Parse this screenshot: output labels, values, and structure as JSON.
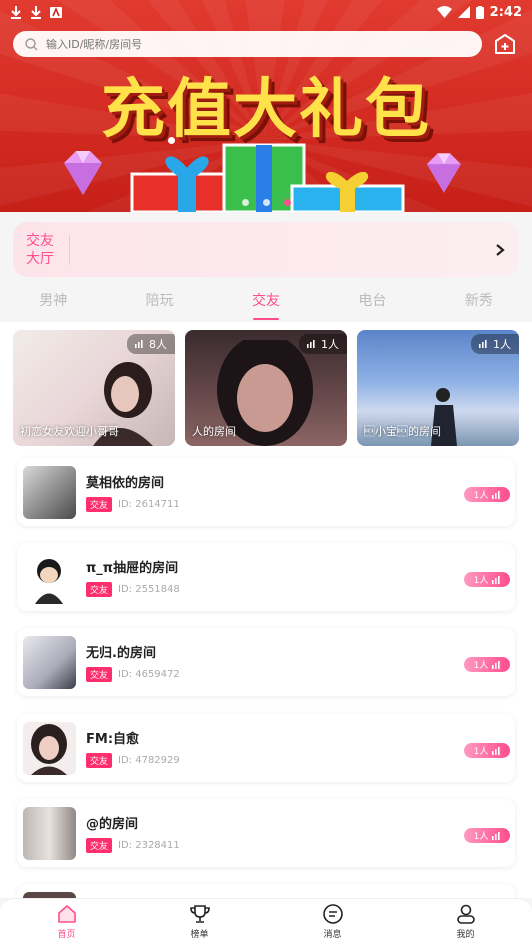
{
  "status": {
    "time": "2:42"
  },
  "search": {
    "placeholder": "输入ID/昵称/房间号"
  },
  "banner": {
    "title": "充值大礼包"
  },
  "hall": {
    "label": "交友大厅"
  },
  "tabs": [
    "男神",
    "陪玩",
    "交友",
    "电台",
    "新秀"
  ],
  "active_tab": "交友",
  "featured": [
    {
      "name": "初恋女友欢迎小哥哥",
      "count": "8人"
    },
    {
      "name": "人的房间",
      "count": "1人"
    },
    {
      "name": "\u0011小宝\u0011的房间",
      "count": "1人"
    }
  ],
  "rooms": [
    {
      "name": "莫相依的房间",
      "tag": "交友",
      "id": "ID: 2614711",
      "online": "1人"
    },
    {
      "name": "π_π抽屉的房间",
      "tag": "交友",
      "id": "ID: 2551848",
      "online": "1人"
    },
    {
      "name": "无归.的房间",
      "tag": "交友",
      "id": "ID: 4659472",
      "online": "1人"
    },
    {
      "name": "FM:自愈",
      "tag": "交友",
      "id": "ID: 4782929",
      "online": "1人"
    },
    {
      "name": "@的房间",
      "tag": "交友",
      "id": "ID: 2328411",
      "online": "1人"
    }
  ],
  "nav": [
    {
      "label": "首页",
      "icon": "home-icon"
    },
    {
      "label": "榜单",
      "icon": "trophy-icon"
    },
    {
      "label": "消息",
      "icon": "message-icon"
    },
    {
      "label": "我的",
      "icon": "profile-icon"
    }
  ],
  "colors": {
    "accent": "#ff4d8d",
    "banner": "#d22a20",
    "title": "#ffe14a"
  }
}
